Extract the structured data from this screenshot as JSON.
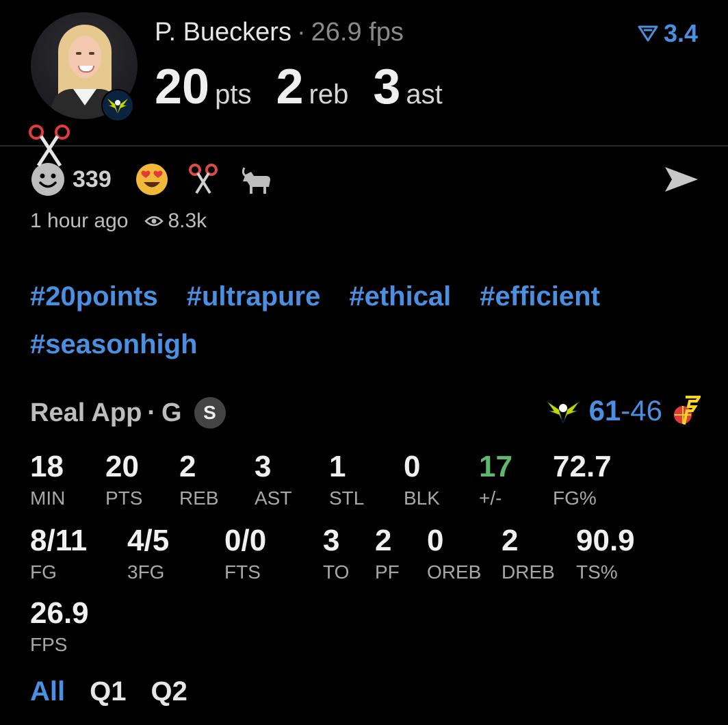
{
  "player": {
    "name": "P. Bueckers",
    "fps_text": "26.9 fps",
    "rating": "3.4",
    "headline": [
      {
        "num": "20",
        "label": "pts"
      },
      {
        "num": "2",
        "label": "reb"
      },
      {
        "num": "3",
        "label": "ast"
      }
    ]
  },
  "reactions": {
    "count": "339",
    "emojis": [
      "smiley-face-icon",
      "heart-eyes-emoji-icon",
      "scissors-icon",
      "goat-icon"
    ]
  },
  "meta": {
    "time": "1 hour ago",
    "views": "8.3k"
  },
  "tags": [
    "#20points",
    "#ultrapure",
    "#ethical",
    "#efficient",
    "#seasonhigh"
  ],
  "game": {
    "source": "Real App",
    "position": "G",
    "badge": "S",
    "home_score": "61",
    "dash": "-",
    "away_score": "46"
  },
  "stats": {
    "row1": [
      {
        "value": "18",
        "label": "MIN"
      },
      {
        "value": "20",
        "label": "PTS"
      },
      {
        "value": "2",
        "label": "REB"
      },
      {
        "value": "3",
        "label": "AST"
      },
      {
        "value": "1",
        "label": "STL"
      },
      {
        "value": "0",
        "label": "BLK"
      },
      {
        "value": "17",
        "label": "+/-"
      },
      {
        "value": "72.7",
        "label": "FG%"
      }
    ],
    "row2": [
      {
        "value": "8/11",
        "label": "FG"
      },
      {
        "value": "4/5",
        "label": "3FG"
      },
      {
        "value": "0/0",
        "label": "FTS"
      },
      {
        "value": "3",
        "label": "TO"
      },
      {
        "value": "2",
        "label": "PF"
      },
      {
        "value": "0",
        "label": "OREB"
      },
      {
        "value": "2",
        "label": "DREB"
      },
      {
        "value": "90.9",
        "label": "TS%"
      }
    ],
    "row3": [
      {
        "value": "26.9",
        "label": "FPS"
      }
    ]
  },
  "filters": {
    "all": "All",
    "q1": "Q1",
    "q2": "Q2"
  },
  "colors": {
    "accent": "#4a8fe0",
    "positive": "#5fb870",
    "background": "#000000"
  }
}
